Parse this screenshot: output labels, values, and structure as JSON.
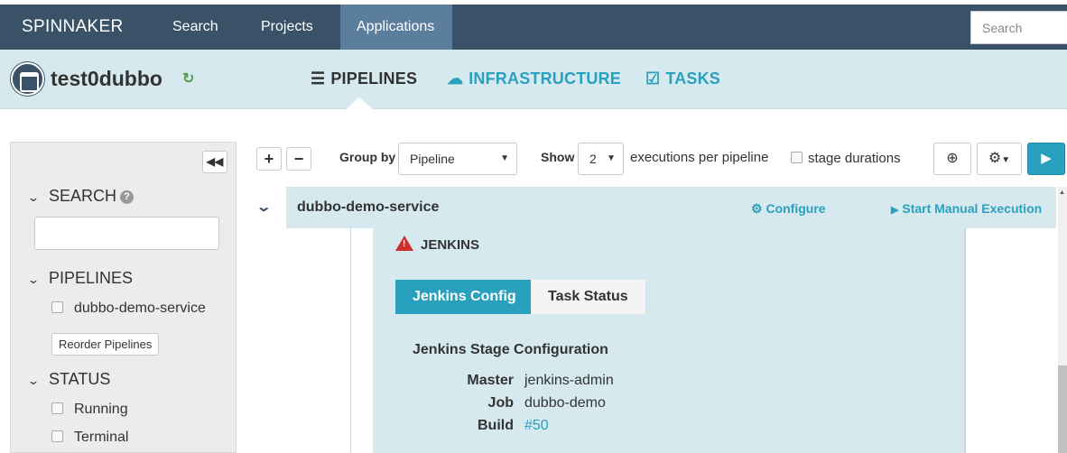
{
  "nav": {
    "brand": "SPINNAKER",
    "links": [
      "Search",
      "Projects",
      "Applications"
    ],
    "search_placeholder": "Search"
  },
  "app": {
    "name": "test0dubbo",
    "tabs": [
      "PIPELINES",
      "INFRASTRUCTURE",
      "TASKS"
    ]
  },
  "sidebar": {
    "collapse_glyph": "◀◀",
    "search_heading": "SEARCH",
    "pipelines_heading": "PIPELINES",
    "pipeline_items": [
      "dubbo-demo-service"
    ],
    "reorder_label": "Reorder Pipelines",
    "status_heading": "STATUS",
    "status_items": [
      "Running",
      "Terminal"
    ]
  },
  "toolbar": {
    "expand_glyph": "+",
    "collapse_glyph": "−",
    "group_by_label": "Group by",
    "group_by_value": "Pipeline",
    "show_label": "Show",
    "show_value": "2",
    "executions_text": "executions per pipeline",
    "durations_label": "stage durations"
  },
  "pipeline": {
    "name": "dubbo-demo-service",
    "configure_label": "Configure",
    "start_label": "Start Manual Execution"
  },
  "stage": {
    "title": "JENKINS",
    "tabs": [
      "Jenkins Config",
      "Task Status"
    ],
    "config_title": "Jenkins Stage Configuration",
    "fields": [
      {
        "key": "Master",
        "value": "jenkins-admin"
      },
      {
        "key": "Job",
        "value": "dubbo-demo"
      },
      {
        "key": "Build",
        "value": "#50"
      }
    ]
  },
  "colors": {
    "nav_bg": "#3a5268",
    "accent": "#2aa0bf",
    "band_bg": "#d5e9ee",
    "warning": "#c9302c"
  }
}
